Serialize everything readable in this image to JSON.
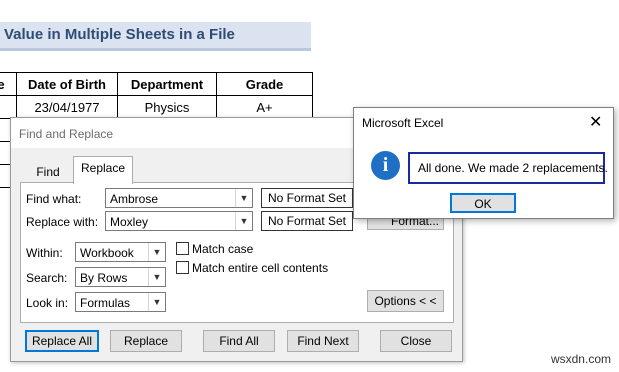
{
  "sheet": {
    "title": "Value in Multiple Sheets in a File",
    "headers": [
      "e",
      "Date of Birth",
      "Department",
      "Grade"
    ],
    "row1": [
      "",
      "23/04/1977",
      "Physics",
      "A+"
    ]
  },
  "find_replace": {
    "window_title": "Find and Replace",
    "tabs": {
      "find": "Find",
      "replace": "Replace"
    },
    "find_what_label": "Find what:",
    "find_what_value": "Ambrose",
    "replace_with_label": "Replace with:",
    "replace_with_value": "Moxley",
    "no_format_1": "No Format Set",
    "no_format_2": "No Format Set",
    "format_button_partial": "Format...",
    "within_label": "Within:",
    "within_value": "Workbook",
    "search_label": "Search:",
    "search_value": "By Rows",
    "lookin_label": "Look in:",
    "lookin_value": "Formulas",
    "match_case": "Match case",
    "match_entire": "Match entire cell contents",
    "options_button": "Options < <",
    "buttons": {
      "replace_all": "Replace All",
      "replace": "Replace",
      "find_all": "Find All",
      "find_next": "Find Next",
      "close": "Close"
    }
  },
  "message_box": {
    "title": "Microsoft Excel",
    "close_glyph": "✕",
    "icon_glyph": "i",
    "message": "All done. We made 2 replacements.",
    "ok": "OK"
  },
  "watermark": "wsxdn.com",
  "colors": {
    "accent": "#0078d7",
    "title_band": "#dbe3f1",
    "title_text": "#2f4d74",
    "info_icon": "#1f6fc5"
  }
}
